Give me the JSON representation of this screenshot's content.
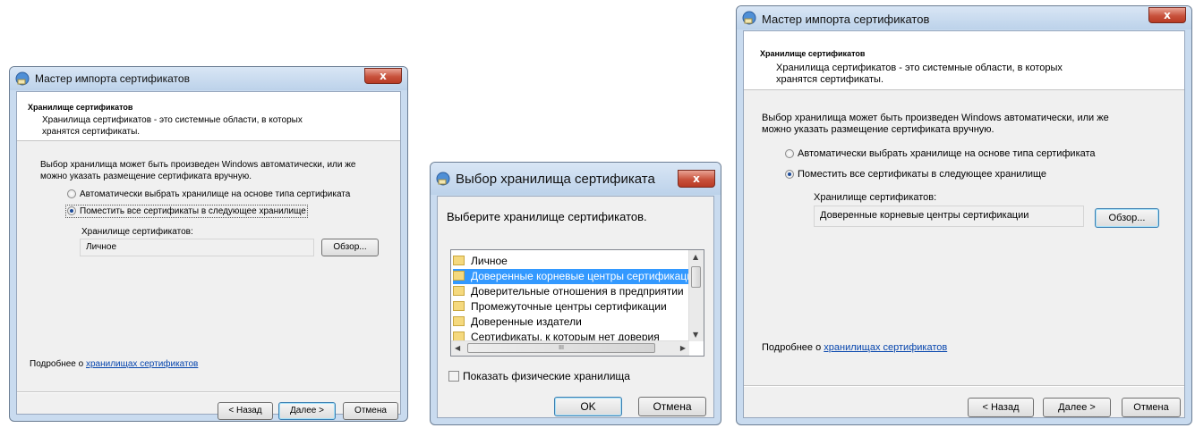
{
  "left_wizard": {
    "title": "Мастер импорта сертификатов",
    "close_glyph": "x",
    "header_title": "Хранилище сертификатов",
    "header_desc": "Хранилища сертификатов - это системные области, в которых\nхранятся сертификаты.",
    "intro": "Выбор хранилища может быть произведен Windows автоматически, или же\nможно указать размещение сертификата вручную.",
    "radio_auto": "Автоматически выбрать хранилище на основе типа сертификата",
    "radio_manual": "Поместить все сертификаты в следующее хранилище",
    "store_label": "Хранилище сертификатов:",
    "store_value": "Личное",
    "browse": "Обзор...",
    "more_prefix": "Подробнее о ",
    "more_link": "хранилищах сертификатов",
    "back": "< Назад",
    "next": "Далее >",
    "cancel": "Отмена"
  },
  "select_dialog": {
    "title": "Выбор хранилища сертификата",
    "close_glyph": "x",
    "prompt": "Выберите хранилище сертификатов.",
    "items": [
      "Личное",
      "Доверенные корневые центры сертификации",
      "Доверительные отношения в предприятии",
      "Промежуточные центры сертификации",
      "Доверенные издатели",
      "Сертификаты, к которым нет доверия"
    ],
    "selected_index": 1,
    "hscroll_grip": "III",
    "show_physical": "Показать физические хранилища",
    "ok": "OK",
    "cancel": "Отмена"
  },
  "right_wizard": {
    "title": "Мастер импорта сертификатов",
    "close_glyph": "x",
    "header_title": "Хранилище сертификатов",
    "header_desc": "Хранилища сертификатов - это системные области, в которых\nхранятся сертификаты.",
    "intro": "Выбор хранилища может быть произведен Windows автоматически, или же\nможно указать размещение сертификата вручную.",
    "radio_auto": "Автоматически выбрать хранилище на основе типа сертификата",
    "radio_manual": "Поместить все сертификаты в следующее хранилище",
    "store_label": "Хранилище сертификатов:",
    "store_value": "Доверенные корневые центры сертификации",
    "browse": "Обзор...",
    "more_prefix": "Подробнее о ",
    "more_link": "хранилищах сертификатов",
    "back": "< Назад",
    "next": "Далее >",
    "cancel": "Отмена"
  },
  "colors": {
    "selection": "#3399ff",
    "link": "#0645ad",
    "close_button": "#c8523c"
  }
}
